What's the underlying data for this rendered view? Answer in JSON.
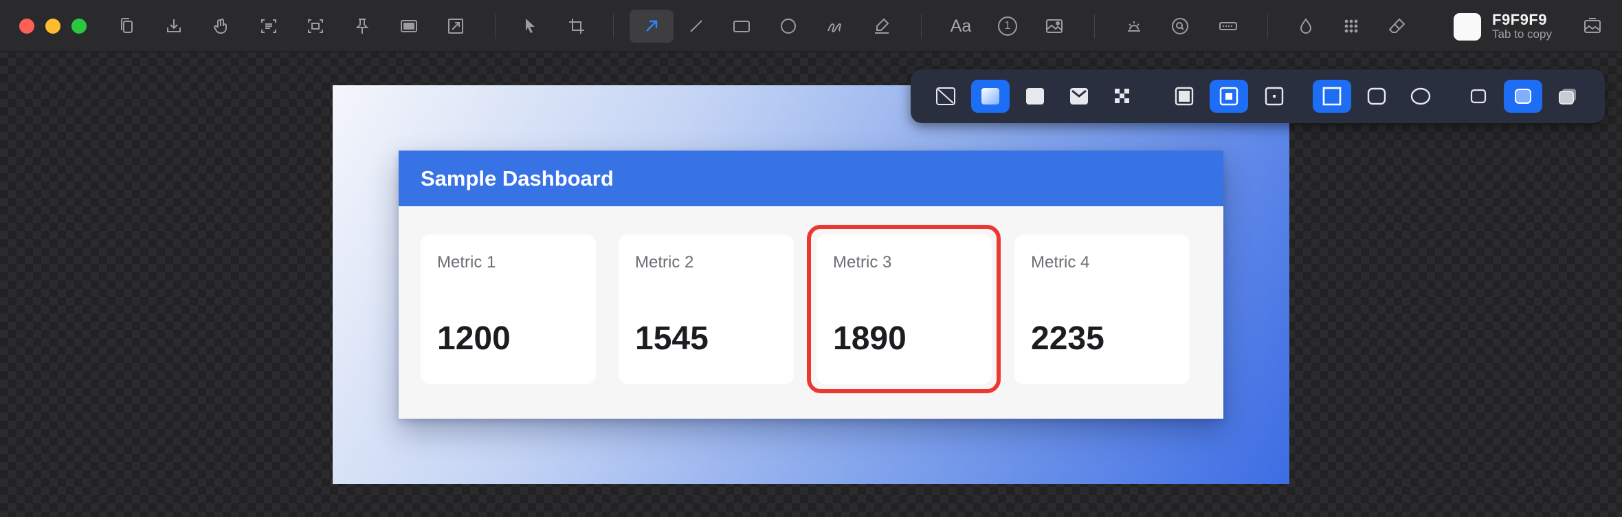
{
  "window": {
    "traffic_lights": [
      "close",
      "minimize",
      "maximize"
    ]
  },
  "toolbar": {
    "groups": [
      [
        "copy",
        "save",
        "hand",
        "ocr-text",
        "capture-area",
        "pin",
        "background",
        "resize"
      ],
      [
        "select",
        "crop"
      ],
      [
        "arrow",
        "line",
        "rectangle",
        "ellipse",
        "pen",
        "highlighter"
      ],
      [
        "text",
        "counter",
        "image"
      ],
      [
        "spotlight",
        "magnifier",
        "blur"
      ],
      [
        "color-picker",
        "pixelate",
        "eraser"
      ]
    ],
    "active_tool": "arrow",
    "text_tool_label": "Aa",
    "counter_label": "1",
    "color_hex": "F9F9F9",
    "color_hint": "Tab to copy",
    "color_value": "#F9F9F9"
  },
  "palette": {
    "background_options": [
      "none",
      "gradient",
      "solid",
      "wallpaper",
      "transparent"
    ],
    "selected_background": "gradient",
    "padding_options": [
      "large",
      "medium",
      "small"
    ],
    "selected_padding": "medium",
    "corner_options": [
      "square",
      "rounded",
      "circle"
    ],
    "selected_corner": "square",
    "shadow_options": [
      "none",
      "soft",
      "stacked"
    ],
    "selected_shadow": "soft",
    "accent": "#1D6EF5"
  },
  "dashboard": {
    "title": "Sample Dashboard",
    "header_color": "#3873E5",
    "metrics": [
      {
        "label": "Metric 1",
        "value": "1200"
      },
      {
        "label": "Metric 2",
        "value": "1545"
      },
      {
        "label": "Metric 3",
        "value": "1890"
      },
      {
        "label": "Metric 4",
        "value": "2235"
      }
    ],
    "highlighted_metric": "Metric 3",
    "highlight_color": "#ED3832"
  }
}
